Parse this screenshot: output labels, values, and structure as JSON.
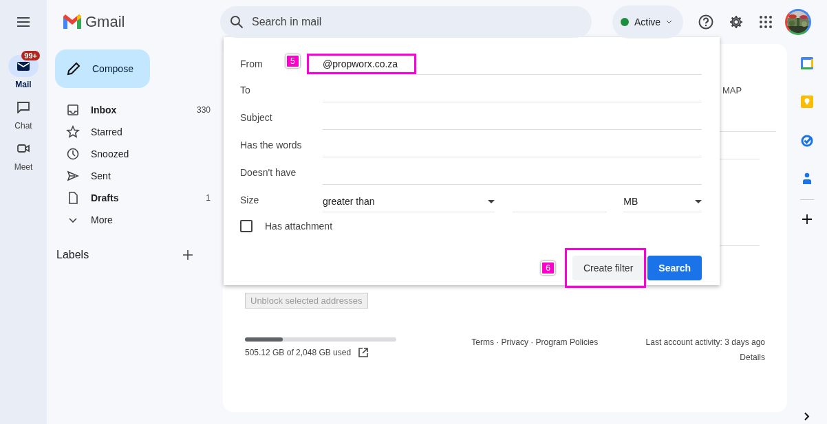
{
  "app": {
    "name": "Gmail"
  },
  "rail": [
    {
      "label": "Mail",
      "selected": true,
      "badge": "99+"
    },
    {
      "label": "Chat",
      "selected": false
    },
    {
      "label": "Meet",
      "selected": false
    }
  ],
  "compose": "Compose",
  "folders": [
    {
      "label": "Inbox",
      "count": "330",
      "bold": true
    },
    {
      "label": "Starred",
      "bold": false
    },
    {
      "label": "Snoozed",
      "bold": false
    },
    {
      "label": "Sent",
      "bold": false
    },
    {
      "label": "Drafts",
      "count": "1",
      "bold": true
    },
    {
      "label": "More",
      "bold": false
    }
  ],
  "labels_heading": "Labels",
  "search": {
    "placeholder": "Search in mail"
  },
  "status": {
    "label": "Active",
    "color": "#1e8e3e"
  },
  "background_card": {
    "heading_fragment": "MAP",
    "unblock_button": {
      "label": "Unblock selected addresses",
      "disabled": true
    }
  },
  "filter": {
    "fields": [
      {
        "label": "From",
        "value": "@propworx.co.za",
        "annotation": "5"
      },
      {
        "label": "To"
      },
      {
        "label": "Subject"
      },
      {
        "label": "Has the words"
      },
      {
        "label": "Doesn't have"
      }
    ],
    "size": {
      "label": "Size",
      "operator": "greater than",
      "unit": "MB"
    },
    "has_attachment": {
      "label": "Has attachment",
      "checked": false
    },
    "create_filter": {
      "label": "Create filter",
      "annotation": "6"
    },
    "search_button": "Search"
  },
  "footer": {
    "storage": {
      "level": 0.25,
      "text": "505.12 GB of 2,048 GB used"
    },
    "links": "Terms · Privacy · Program Policies",
    "activity": "Last account activity: 3 days ago",
    "details": "Details"
  }
}
